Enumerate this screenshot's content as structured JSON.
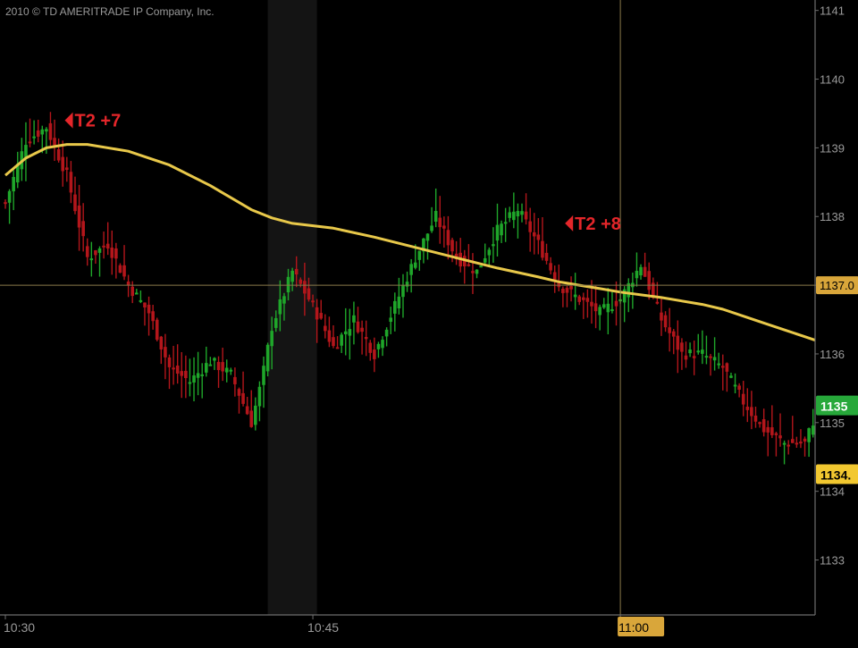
{
  "copyright": "2010 © TD AMERITRADE IP Company, Inc.",
  "colors": {
    "background": "#000000",
    "up": "#1fa62a",
    "down": "#b3161b",
    "moving_average": "#e8c84a",
    "annotation": "#e4262a",
    "axis": "#6e6e6e",
    "crosshair": "#8a7a4a",
    "highlight_band": "#141414",
    "last_price_bg": "#f2c830",
    "green_tag_bg": "#27a83a",
    "crosshair_tag_bg": "#d9a63a"
  },
  "chart_data": {
    "type": "line",
    "subtype": "intraday-candlestick",
    "title": "",
    "xlabel": "",
    "ylabel": "",
    "x_ticks": [
      "10:30",
      "10:45",
      "11:00"
    ],
    "x_tick_minutes": [
      0,
      15,
      30
    ],
    "x_range_minutes": [
      0,
      39.5
    ],
    "y_ticks": [
      1133,
      1134,
      1135,
      1136,
      1137,
      1138,
      1139,
      1140,
      1141
    ],
    "ylim": [
      1132.2,
      1141.1
    ],
    "grid": false,
    "highlight_band_minutes": [
      12.8,
      15.2
    ],
    "crosshair": {
      "time": "11:00",
      "minute": 30,
      "price_label": "1137.0",
      "price": 1137.0
    },
    "price_tags": [
      {
        "text": "1135",
        "price": 1135.25,
        "style": "green"
      },
      {
        "text": "1134.",
        "price": 1134.25,
        "style": "last"
      }
    ],
    "annotations": [
      {
        "text": "T2 +7",
        "minute": 2.9,
        "price": 1139.4
      },
      {
        "text": "T2 +8",
        "minute": 27.3,
        "price": 1137.9
      }
    ],
    "moving_average": {
      "minutes": [
        0,
        1,
        2,
        3,
        4,
        6,
        8,
        10,
        12,
        13,
        14,
        16,
        18,
        20,
        22,
        24,
        26,
        27,
        28,
        29,
        30,
        32,
        34,
        35,
        36,
        37,
        38,
        39,
        39.5
      ],
      "values": [
        1138.6,
        1138.85,
        1139.0,
        1139.05,
        1139.05,
        1138.95,
        1138.75,
        1138.45,
        1138.1,
        1137.98,
        1137.9,
        1137.83,
        1137.7,
        1137.55,
        1137.4,
        1137.25,
        1137.12,
        1137.05,
        1137.0,
        1136.95,
        1136.9,
        1136.82,
        1136.72,
        1136.65,
        1136.55,
        1136.45,
        1136.35,
        1136.25,
        1136.2
      ]
    },
    "price_path": {
      "minutes": [
        0,
        1,
        2,
        3,
        4,
        5,
        6,
        7,
        8,
        9,
        10,
        11,
        12,
        12.5,
        13,
        14,
        15,
        16,
        17,
        18,
        19,
        20,
        21,
        22,
        23,
        24,
        25,
        26,
        27,
        28,
        29,
        30,
        31,
        32,
        33,
        34,
        35,
        36,
        37,
        38,
        39,
        39.5
      ],
      "values": [
        1138.2,
        1139.1,
        1139.3,
        1138.6,
        1137.4,
        1137.6,
        1137.0,
        1136.6,
        1135.8,
        1135.6,
        1135.9,
        1135.7,
        1135.0,
        1135.6,
        1136.4,
        1137.2,
        1136.7,
        1136.1,
        1136.5,
        1136.0,
        1136.7,
        1137.4,
        1138.0,
        1137.4,
        1137.2,
        1137.8,
        1138.1,
        1137.6,
        1137.0,
        1136.8,
        1136.6,
        1136.8,
        1137.3,
        1136.5,
        1136.0,
        1136.0,
        1135.8,
        1135.3,
        1134.9,
        1134.7,
        1134.7,
        1135.1
      ]
    }
  }
}
